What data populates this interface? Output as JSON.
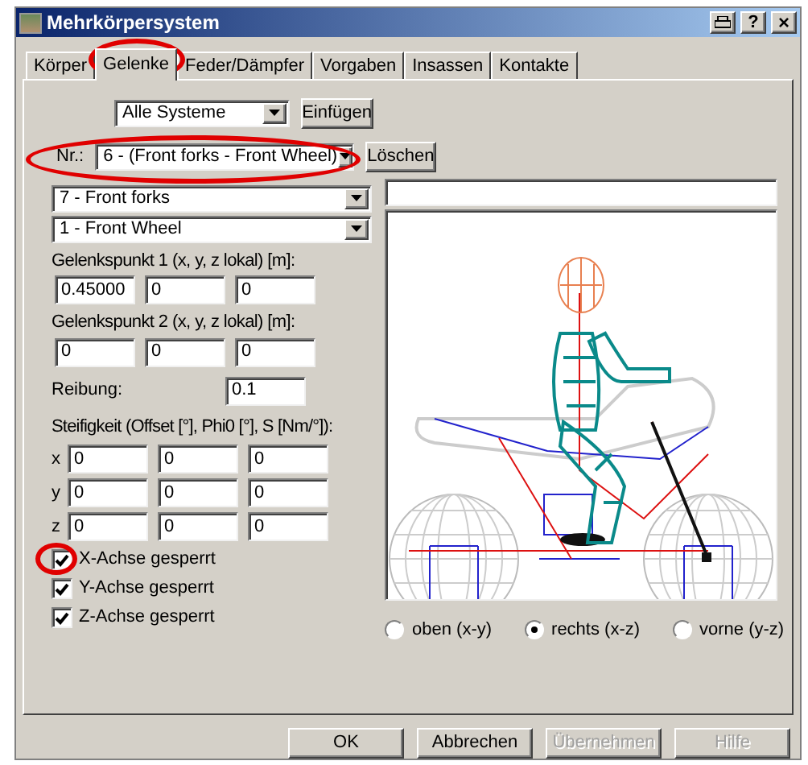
{
  "window": {
    "title": "Mehrkörpersystem",
    "help_button": "?",
    "close_button": "×"
  },
  "tabs": [
    {
      "label": "Körper",
      "selected": false
    },
    {
      "label": "Gelenke",
      "selected": true
    },
    {
      "label": "Feder/Dämpfer",
      "selected": false
    },
    {
      "label": "Vorgaben",
      "selected": false
    },
    {
      "label": "Insassen",
      "selected": false
    },
    {
      "label": "Kontakte",
      "selected": false
    }
  ],
  "system_select": {
    "value": "Alle Systeme"
  },
  "insert_button": "Einfügen",
  "joint_select": {
    "label": "Nr.:",
    "value": "6 - (Front forks - Front Wheel)"
  },
  "delete_button": "Löschen",
  "body_1_select": {
    "value": "7 - Front forks"
  },
  "body_2_select": {
    "value": "1 - Front Wheel"
  },
  "point_1": {
    "label": "Gelenkspunkt 1 (x, y, z lokal) [m]:",
    "values": [
      "0.45000",
      "0",
      "0"
    ]
  },
  "point_2": {
    "label": "Gelenkspunkt 2 (x, y, z lokal) [m]:",
    "values": [
      "0",
      "0",
      "0"
    ]
  },
  "friction": {
    "label": "Reibung:",
    "value": "0.1"
  },
  "stiffness": {
    "label": "Steifigkeit (Offset [°], Phi0 [°], S [Nm/°]):",
    "rows": [
      {
        "axis": "x",
        "values": [
          "0",
          "0",
          "0"
        ]
      },
      {
        "axis": "y",
        "values": [
          "0",
          "0",
          "0"
        ]
      },
      {
        "axis": "z",
        "values": [
          "0",
          "0",
          "0"
        ]
      }
    ]
  },
  "locks": [
    {
      "label": "X-Achse gesperrt",
      "checked": true
    },
    {
      "label": "Y-Achse gesperrt",
      "checked": true
    },
    {
      "label": "Z-Achse gesperrt",
      "checked": true
    }
  ],
  "views": [
    {
      "label": "oben (x-y)",
      "selected": false
    },
    {
      "label": "rechts (x-z)",
      "selected": true
    },
    {
      "label": "vorne (y-z)",
      "selected": false
    }
  ],
  "buttons": [
    {
      "label": "OK",
      "disabled": false
    },
    {
      "label": "Abbrechen",
      "disabled": false
    },
    {
      "label": "Übernehmen",
      "disabled": true
    },
    {
      "label": "Hilfe",
      "disabled": true
    }
  ]
}
